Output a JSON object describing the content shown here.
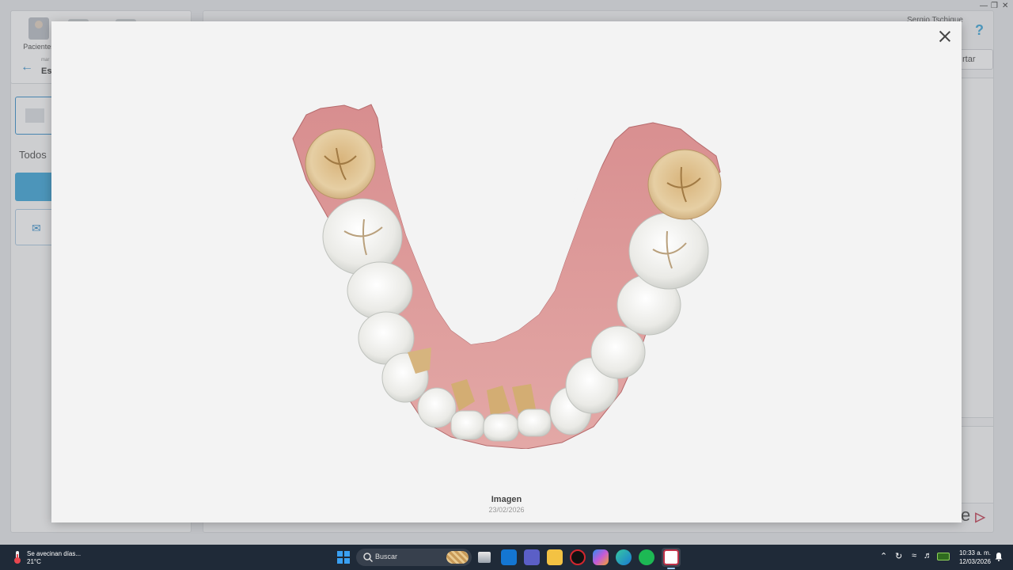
{
  "background_app": {
    "nav_patients_label": "Pacientes",
    "breadcrumb_small": "mar",
    "breadcrumb_title": "Esi",
    "filter_all": "Todos",
    "user_name": "Sergio Tschique",
    "help_symbol": "?",
    "export_label": "rtar",
    "brand_partial": "e"
  },
  "modal": {
    "caption_title": "Imagen",
    "caption_date": "23/02/2026",
    "close_icon": "close-icon"
  },
  "taskbar": {
    "weather_line1": "Se avecinan días...",
    "weather_line2": "21°C",
    "search_placeholder": "Buscar",
    "time": "10:33 a. m.",
    "date": "12/03/2026",
    "apps": [
      "task-view-icon",
      "outlook-icon",
      "teams-icon",
      "file-explorer-icon",
      "record-icon",
      "copilot-icon",
      "edge-icon",
      "spotify-icon",
      "dental-app-icon"
    ]
  },
  "colors": {
    "accent": "#35a4d9",
    "taskbar": "#1f2a38",
    "modal_bg": "#f3f3f3",
    "gum": "#d99092",
    "tooth": "#f2f2ef"
  }
}
